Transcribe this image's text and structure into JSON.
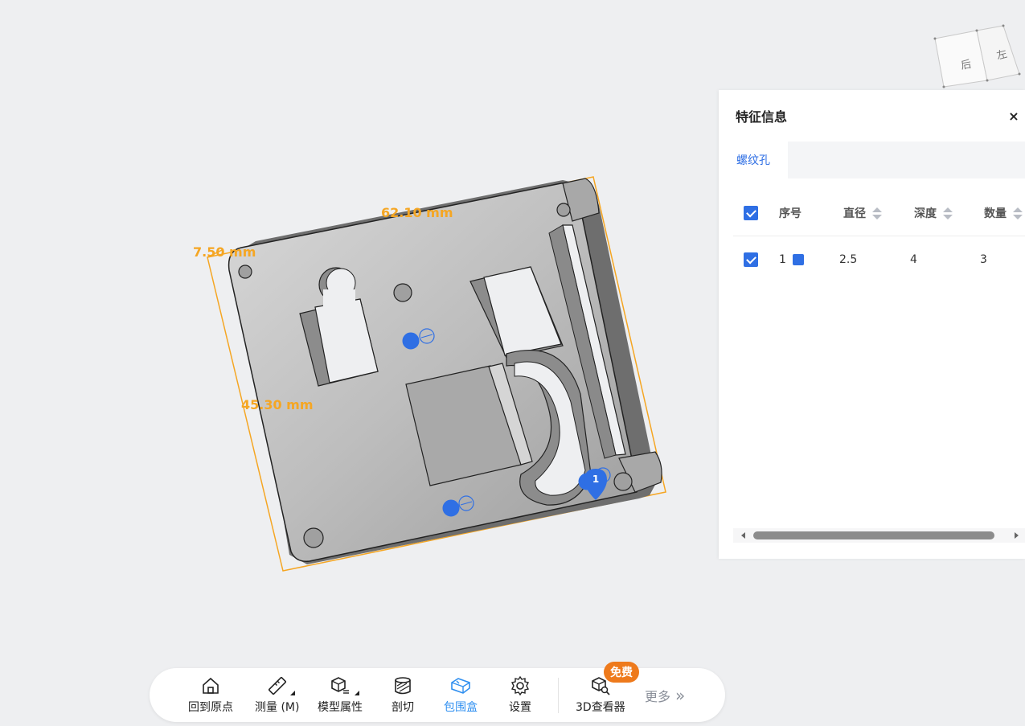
{
  "viewport": {
    "dimensions": {
      "length": "62.10 mm",
      "height": "7.50 mm",
      "width": "45.30 mm"
    },
    "feature_marker_label": "1",
    "colors": {
      "bounding_box": "#f5a623",
      "marker": "#2f6fe4",
      "part": "#c4c4c4"
    }
  },
  "view_cube": {
    "face_back": "后",
    "face_left": "左"
  },
  "feature_panel": {
    "title": "特征信息",
    "close_label": "×",
    "tab_label": "螺纹孔",
    "columns": [
      "序号",
      "直径",
      "深度",
      "数量"
    ],
    "rows": [
      {
        "index": "1",
        "diameter": "2.5",
        "depth": "4",
        "count": "3"
      }
    ]
  },
  "toolbar": {
    "home": "回到原点",
    "measure": "测量 (M)",
    "model_props": "模型属性",
    "section": "剖切",
    "bbox": "包围盒",
    "settings": "设置",
    "viewer": "3D查看器",
    "free_badge": "免费",
    "more": "更多",
    "more_icon": "»",
    "accent": "#2f8ff0"
  }
}
